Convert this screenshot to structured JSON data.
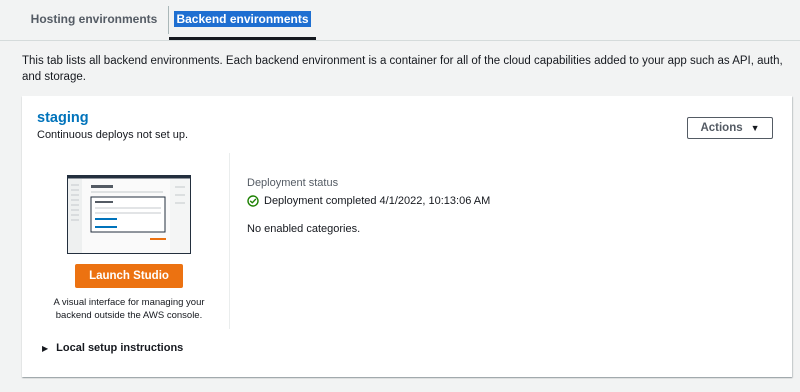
{
  "tabs": [
    {
      "label": "Hosting environments",
      "active": false
    },
    {
      "label": "Backend environments",
      "active": true
    }
  ],
  "intro": "This tab lists all backend environments. Each backend environment is a container for all of the cloud capabilities added to your app such as API, auth, and storage.",
  "environment": {
    "name": "staging",
    "subtitle": "Continuous deploys not set up.",
    "actions_label": "Actions",
    "launch_label": "Launch Studio",
    "studio_description": "A visual interface for managing your backend outside the AWS console.",
    "status_label": "Deployment status",
    "status_text": "Deployment completed 4/1/2022, 10:13:06 AM",
    "status_color": "#1d8102",
    "categories_text": "No enabled categories.",
    "local_setup_label": "Local setup instructions"
  },
  "colors": {
    "accent": "#0073bb",
    "launch": "#ec7211",
    "selected_tab_highlight": "#1f6fd1"
  },
  "icons": [
    "check-circle-icon",
    "caret-down-icon",
    "caret-right-icon",
    "studio-illustration"
  ]
}
